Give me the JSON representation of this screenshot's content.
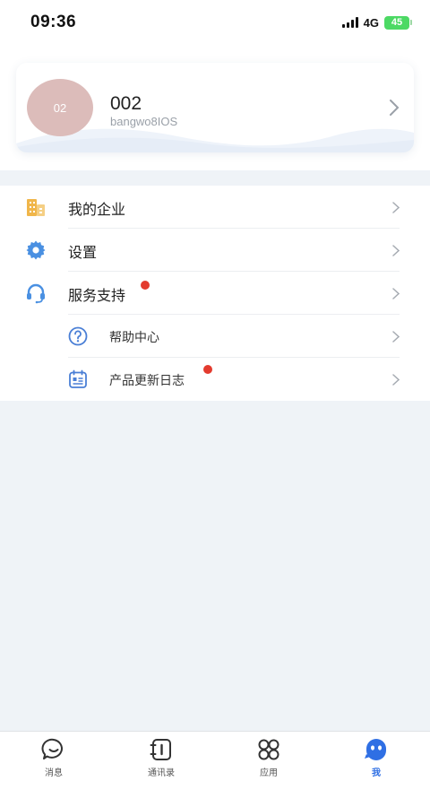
{
  "status": {
    "time": "09:36",
    "network": "4G",
    "battery": "45"
  },
  "profile": {
    "avatar_text": "02",
    "name": "002",
    "subtitle": "bangwo8IOS"
  },
  "menu": {
    "items": [
      {
        "label": "我的企业",
        "icon": "building-icon",
        "badge": false
      },
      {
        "label": "设置",
        "icon": "gear-icon",
        "badge": false
      },
      {
        "label": "服务支持",
        "icon": "headset-icon",
        "badge": true
      }
    ],
    "sub_items": [
      {
        "label": "帮助中心",
        "icon": "help-circle-icon",
        "badge": false
      },
      {
        "label": "产品更新日志",
        "icon": "calendar-log-icon",
        "badge": true
      }
    ]
  },
  "tabbar": {
    "tabs": [
      {
        "label": "消息",
        "icon": "chat-bubble-icon",
        "active": false
      },
      {
        "label": "通讯录",
        "icon": "contacts-book-icon",
        "active": false
      },
      {
        "label": "应用",
        "icon": "apps-grid-icon",
        "active": false
      },
      {
        "label": "我",
        "icon": "user-profile-icon",
        "active": true
      }
    ]
  },
  "colors": {
    "accent": "#2f6fe4",
    "badge_red": "#e33b2e",
    "avatar_bg": "#dcbcba",
    "icon_blue": "#4a90e2",
    "icon_gold": "#f0b64a"
  }
}
